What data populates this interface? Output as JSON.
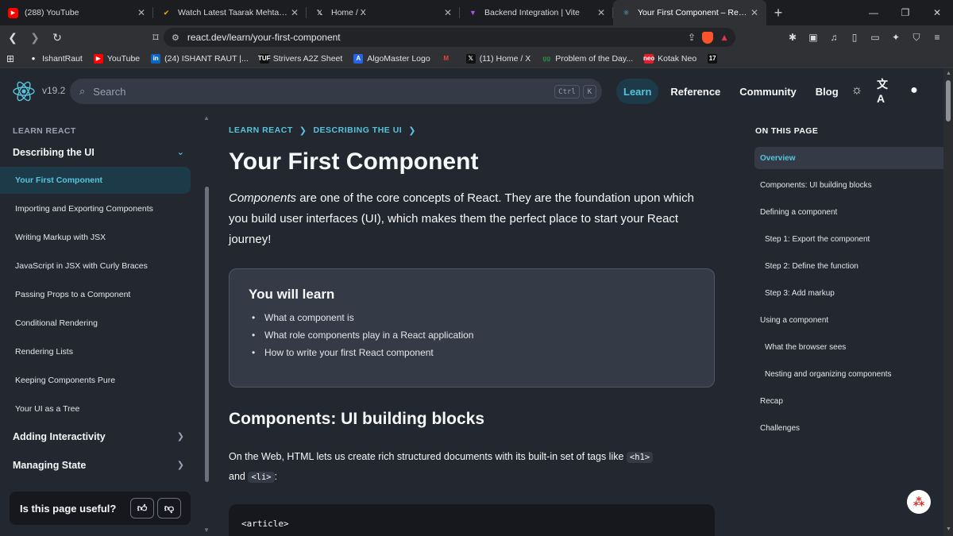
{
  "browser": {
    "tabs": [
      {
        "title": "(288) YouTube",
        "favicon": "youtube-icon",
        "color": "#ff0000",
        "active": false
      },
      {
        "title": "Watch Latest Taarak Mehta Ka Oo",
        "favicon": "check-icon",
        "color": "#f5b400",
        "active": false
      },
      {
        "title": "Home / X",
        "favicon": "x-logo-icon",
        "color": "#ffffff",
        "active": false
      },
      {
        "title": "Backend Integration | Vite",
        "favicon": "vite-icon",
        "color": "#a855f7",
        "active": false
      },
      {
        "title": "Your First Component – React",
        "favicon": "react-icon",
        "color": "#58c4dc",
        "active": true
      }
    ],
    "new_tab": "+",
    "url": "react.dev/learn/your-first-component",
    "bookmarks": [
      {
        "label": "IshantRaut",
        "icon": "github-icon",
        "color": "#ffffff"
      },
      {
        "label": "YouTube",
        "icon": "youtube-icon",
        "color": "#ff0000"
      },
      {
        "label": "(24) ISHANT RAUT |...",
        "icon": "linkedin-icon",
        "color": "#0a66c2"
      },
      {
        "label": "Strivers A2Z Sheet",
        "icon": "tuf-icon",
        "color": "#111111"
      },
      {
        "label": "AlgoMaster Logo",
        "icon": "algomaster-icon",
        "color": "#2563eb"
      },
      {
        "label": "",
        "icon": "gmail-icon",
        "color": "#ea4335"
      },
      {
        "label": "(11) Home / X",
        "icon": "x-logo-icon",
        "color": "#111111"
      },
      {
        "label": "Problem of the Day...",
        "icon": "gfg-icon",
        "color": "#2f8d46"
      },
      {
        "label": "Kotak Neo",
        "icon": "kotak-icon",
        "color": "#e11d2e"
      },
      {
        "label": "",
        "icon": "tradingview-icon",
        "color": "#111111"
      }
    ]
  },
  "header": {
    "version": "v19.2",
    "search_placeholder": "Search",
    "kbd_ctrl": "Ctrl",
    "kbd_k": "K",
    "nav": [
      {
        "label": "Learn",
        "active": true
      },
      {
        "label": "Reference",
        "active": false
      },
      {
        "label": "Community",
        "active": false
      },
      {
        "label": "Blog",
        "active": false
      }
    ]
  },
  "sidebar": {
    "section": "LEARN REACT",
    "group_open": "Describing the UI",
    "items": [
      "Your First Component",
      "Importing and Exporting Components",
      "Writing Markup with JSX",
      "JavaScript in JSX with Curly Braces",
      "Passing Props to a Component",
      "Conditional Rendering",
      "Rendering Lists",
      "Keeping Components Pure",
      "Your UI as a Tree"
    ],
    "groups_closed": [
      "Adding Interactivity",
      "Managing State"
    ],
    "feedback_question": "Is this page useful?"
  },
  "main": {
    "breadcrumbs": [
      "LEARN REACT",
      "DESCRIBING THE UI"
    ],
    "title": "Your First Component",
    "intro_em": "Components",
    "intro_rest": " are one of the core concepts of React. They are the foundation upon which you build user interfaces (UI), which makes them the perfect place to start your React journey!",
    "learn_title": "You will learn",
    "learn_items": [
      "What a component is",
      "What role components play in a React application",
      "How to write your first React component"
    ],
    "h2": "Components: UI building blocks",
    "para_before": "On the Web, HTML lets us create rich structured documents with its built-in set of tags like ",
    "code_h1": "<h1>",
    "para_and": " and ",
    "code_li": "<li>",
    "para_end": ":",
    "code_line": "<article>"
  },
  "toc": {
    "title": "ON THIS PAGE",
    "items": [
      {
        "label": "Overview",
        "indent": false,
        "active": true
      },
      {
        "label": "Components: UI building blocks",
        "indent": false,
        "active": false
      },
      {
        "label": "Defining a component",
        "indent": false,
        "active": false
      },
      {
        "label": "Step 1: Export the component",
        "indent": true,
        "active": false
      },
      {
        "label": "Step 2: Define the function",
        "indent": true,
        "active": false
      },
      {
        "label": "Step 3: Add markup",
        "indent": true,
        "active": false
      },
      {
        "label": "Using a component",
        "indent": false,
        "active": false
      },
      {
        "label": "What the browser sees",
        "indent": true,
        "active": false
      },
      {
        "label": "Nesting and organizing components",
        "indent": true,
        "active": false
      },
      {
        "label": "Recap",
        "indent": false,
        "active": false
      },
      {
        "label": "Challenges",
        "indent": false,
        "active": false
      }
    ]
  },
  "colors": {
    "accent": "#58c4dc",
    "bg": "#23272f",
    "panel": "#343a46"
  }
}
